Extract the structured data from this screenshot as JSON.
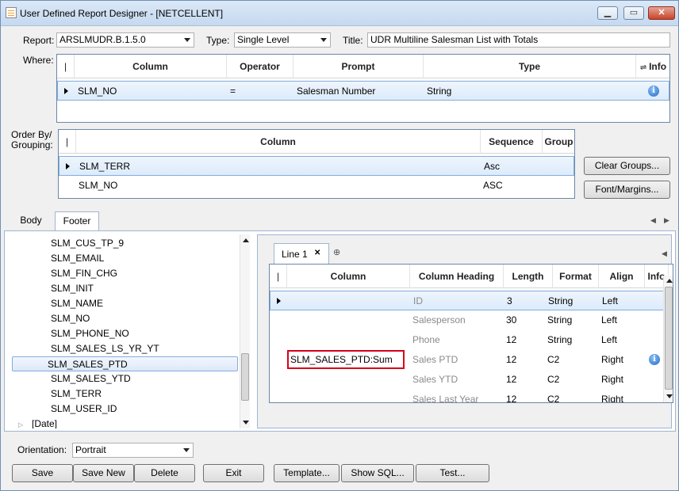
{
  "window": {
    "title": "User Defined Report Designer - [NETCELLENT]",
    "minimize_label": "▁",
    "maximize_label": "▭",
    "close_label": "✕"
  },
  "header": {
    "report_label": "Report:",
    "report_value": "ARSLMUDR.B.1.5.0",
    "type_label": "Type:",
    "type_value": "Single Level",
    "title_label": "Title:",
    "title_value": "UDR Multiline Salesman List with Totals"
  },
  "where": {
    "label": "Where:",
    "columns": [
      "Column",
      "Operator",
      "Prompt",
      "Type",
      "Info"
    ],
    "rows": [
      {
        "column": "SLM_NO",
        "operator": "=",
        "prompt": "Salesman Number",
        "type": "String",
        "info": "i"
      }
    ]
  },
  "orderby": {
    "label": "Order By/\nGrouping:",
    "label_line1": "Order By/",
    "label_line2": "Grouping:",
    "columns": [
      "Column",
      "Sequence",
      "Group"
    ],
    "rows": [
      {
        "column": "SLM_TERR",
        "sequence": "Asc"
      },
      {
        "column": "SLM_NO",
        "sequence": "ASC"
      }
    ]
  },
  "side_buttons": {
    "clear_groups": "Clear Groups...",
    "font_margins": "Font/Margins..."
  },
  "tabs": [
    "Body",
    "Footer"
  ],
  "tree": {
    "items": [
      "SLM_CUS_TP_9",
      "SLM_EMAIL",
      "SLM_FIN_CHG",
      "SLM_INIT",
      "SLM_NAME",
      "SLM_NO",
      "SLM_PHONE_NO",
      "SLM_SALES_LS_YR_YT",
      "SLM_SALES_PTD",
      "SLM_SALES_YTD",
      "SLM_TERR",
      "SLM_USER_ID"
    ],
    "selected": "SLM_SALES_PTD",
    "date_node": "[Date]"
  },
  "line_tab": {
    "label": "Line 1",
    "close": "✕",
    "add": "⊕"
  },
  "footer_grid": {
    "columns": [
      "Column",
      "Column Heading",
      "Length",
      "Format",
      "Align",
      "Info"
    ],
    "rows": [
      {
        "column": "",
        "heading": "ID",
        "length": "3",
        "format": "String",
        "align": "Left",
        "info": ""
      },
      {
        "column": "",
        "heading": "Salesperson",
        "length": "30",
        "format": "String",
        "align": "Left",
        "info": ""
      },
      {
        "column": "",
        "heading": "Phone",
        "length": "12",
        "format": "String",
        "align": "Left",
        "info": ""
      },
      {
        "column": "SLM_SALES_PTD:Sum",
        "heading": "Sales PTD",
        "length": "12",
        "format": "C2",
        "align": "Right",
        "info": "i"
      },
      {
        "column": "",
        "heading": "Sales YTD",
        "length": "12",
        "format": "C2",
        "align": "Right",
        "info": ""
      },
      {
        "column": "",
        "heading": "Sales Last Year",
        "length": "12",
        "format": "C2",
        "align": "Right",
        "info": ""
      }
    ]
  },
  "bottom": {
    "orientation_label": "Orientation:",
    "orientation_value": "Portrait",
    "buttons": {
      "save": "Save",
      "save_new": "Save New",
      "delete": "Delete",
      "exit": "Exit",
      "template": "Template...",
      "show_sql": "Show SQL...",
      "test": "Test..."
    }
  },
  "colors": {
    "selection_border": "#84acdd",
    "highlight_red": "#d8001c",
    "info_blue": "#1f6cc7"
  }
}
